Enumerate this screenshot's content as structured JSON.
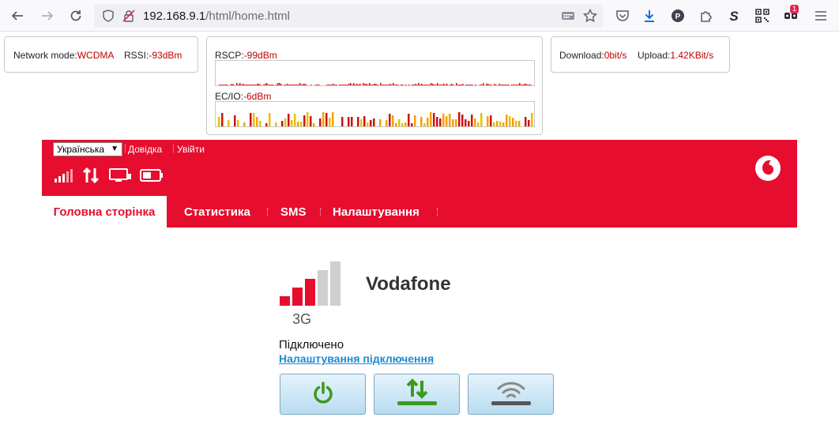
{
  "browser": {
    "url_host": "192.168.9.1",
    "url_path": "/html/home.html",
    "notification_badge": "1"
  },
  "status": {
    "network_mode_label": "Network mode:",
    "network_mode_value": "WCDMA",
    "rssi_label": "RSSI:",
    "rssi_value": "-93dBm",
    "rscp_label": "RSCP:",
    "rscp_value": "-99dBm",
    "ecio_label": "EC/IO:",
    "ecio_value": "-6dBm",
    "download_label": "Download:",
    "download_value": "0bit/s",
    "upload_label": "Upload:",
    "upload_value": "1.42KBit/s"
  },
  "header": {
    "language_selected": "Українська",
    "help_link": "Довідка",
    "logout_link": "Увійти",
    "brand_color": "#e60d2e"
  },
  "nav": {
    "tabs": [
      {
        "label": "Головна сторінка",
        "active": true
      },
      {
        "label": "Статистика",
        "active": false
      },
      {
        "label": "SMS",
        "active": false
      },
      {
        "label": "Налаштування",
        "active": false
      }
    ]
  },
  "main": {
    "operator": "Vodafone",
    "network_type": "3G",
    "signal_bars_level": 3,
    "signal_bars_total": 5,
    "connection_status": "Підключено",
    "connection_settings_link": "Налаштування підключення"
  }
}
